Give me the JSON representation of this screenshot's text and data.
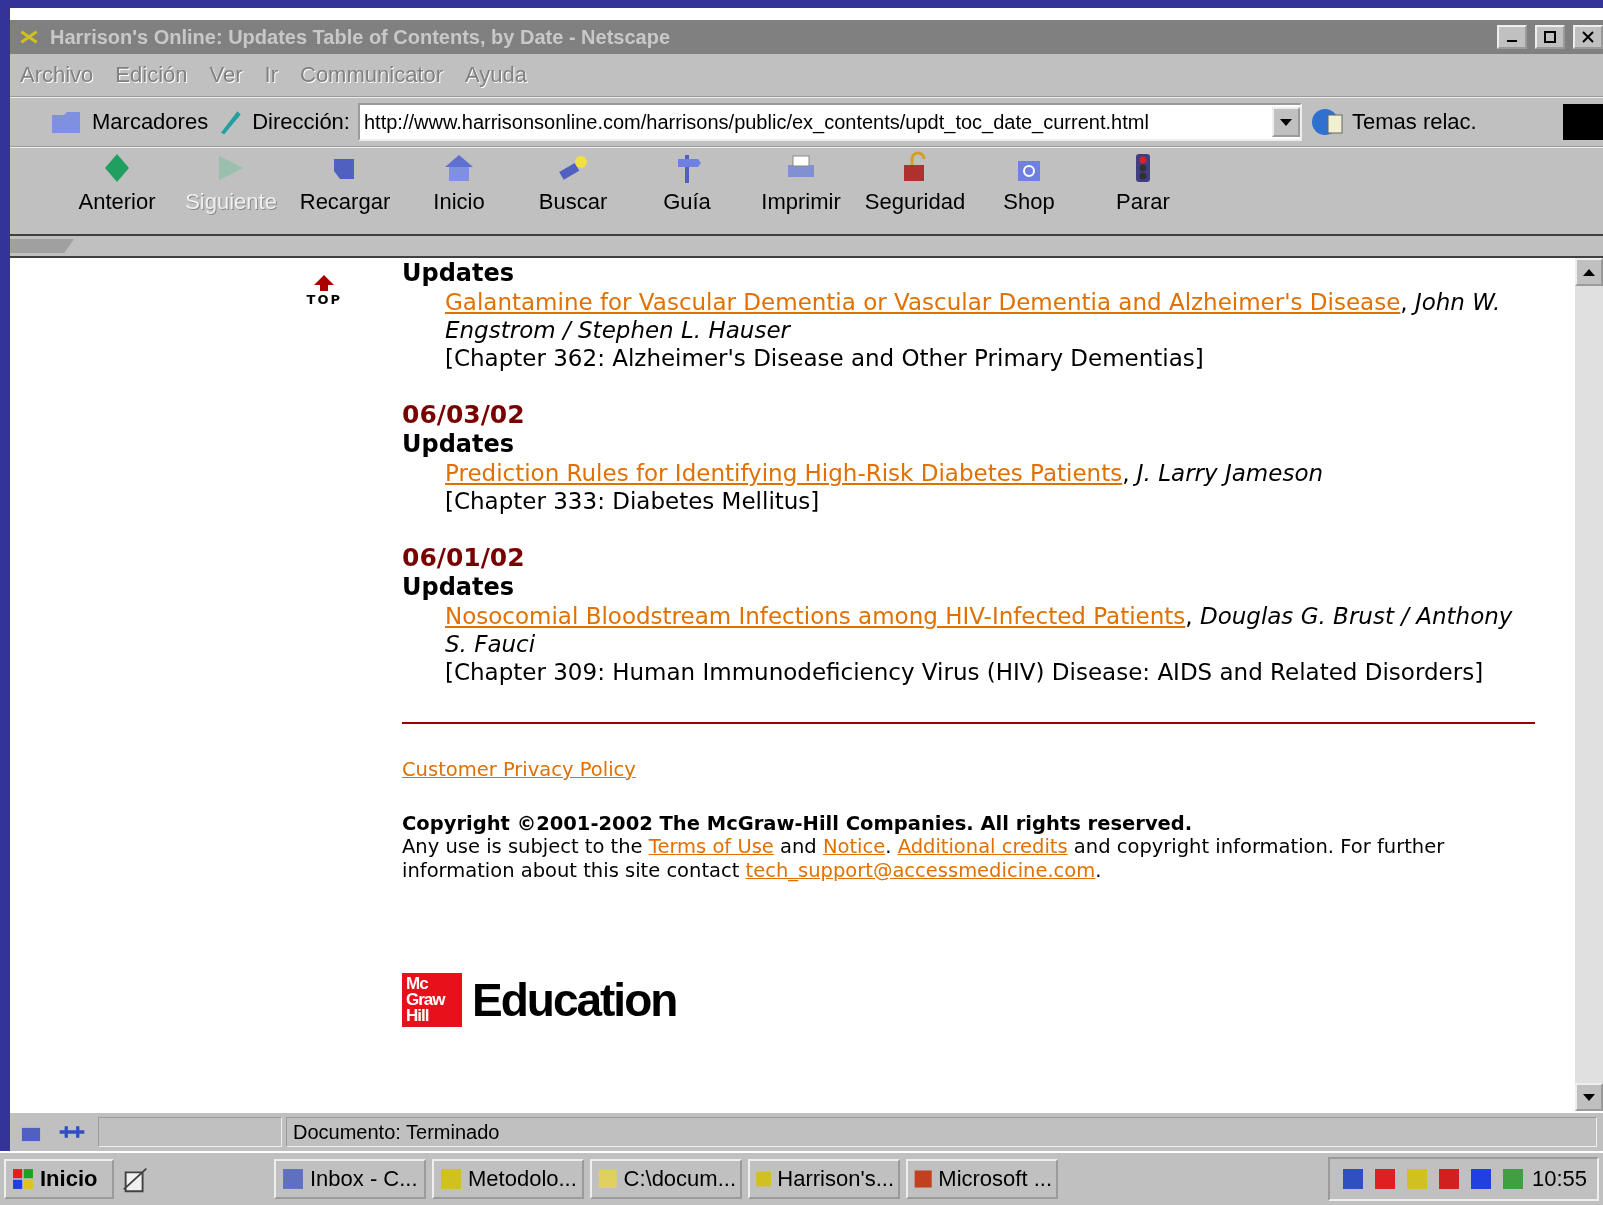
{
  "window": {
    "title": "Harrison's Online: Updates Table of Contents, by Date - Netscape"
  },
  "menu": [
    {
      "label": "Archivo"
    },
    {
      "label": "Edición"
    },
    {
      "label": "Ver"
    },
    {
      "label": "Ir"
    },
    {
      "label": "Communicator"
    },
    {
      "label": "Ayuda"
    }
  ],
  "location_bar": {
    "bookmarks": "Marcadores",
    "address_label": "Dirección:",
    "address": "http://www.harrisonsonline.com/harrisons/public/ex_contents/updt_toc_date_current.html",
    "related": "Temas relac."
  },
  "toolbar": [
    {
      "label": "Anterior",
      "disabled": false
    },
    {
      "label": "Siguiente",
      "disabled": true
    },
    {
      "label": "Recargar",
      "disabled": false
    },
    {
      "label": "Inicio",
      "disabled": false
    },
    {
      "label": "Buscar",
      "disabled": false
    },
    {
      "label": "Guía",
      "disabled": false
    },
    {
      "label": "Imprimir",
      "disabled": false
    },
    {
      "label": "Seguridad",
      "disabled": false
    },
    {
      "label": "Shop",
      "disabled": false
    },
    {
      "label": "Parar",
      "disabled": false
    }
  ],
  "content": {
    "top_label": "TOP",
    "sections": [
      {
        "heading": "Updates",
        "entries": [
          {
            "link": "Galantamine for Vascular Dementia or Vascular Dementia and Alzheimer's Disease",
            "rest": ", *John W. Engstrom / Stephen L. Hauser*",
            "chapter": "[Chapter 362: Alzheimer's Disease and Other Primary Dementias]"
          }
        ]
      },
      {
        "date": "06/03/02",
        "heading": "Updates",
        "entries": [
          {
            "link": "Prediction Rules for Identifying High-Risk Diabetes Patients",
            "rest": ", *J. Larry Jameson*",
            "chapter": "[Chapter 333: Diabetes Mellitus]"
          }
        ]
      },
      {
        "date": "06/01/02",
        "heading": "Updates",
        "entries": [
          {
            "link": "Nosocomial Bloodstream Infections among HIV-Infected Patients",
            "rest": ", *Douglas G. Brust / Anthony S. Fauci*",
            "chapter": "[Chapter 309: Human Immunodeficiency Virus (HIV) Disease: AIDS and Related Disorders]"
          }
        ]
      }
    ],
    "privacy_link": "Customer Privacy Policy",
    "copyright": "Copyright ©2001-2002 The McGraw-Hill Companies. All rights reserved.",
    "notice": [
      {
        "kind": "text",
        "text": "Any use is subject to the "
      },
      {
        "kind": "link",
        "text": "Terms of Use"
      },
      {
        "kind": "text",
        "text": " and "
      },
      {
        "kind": "link",
        "text": "Notice"
      },
      {
        "kind": "text",
        "text": ". "
      },
      {
        "kind": "link",
        "text": "Additional credits"
      },
      {
        "kind": "text",
        "text": " and copyright information. For further information about this site contact "
      },
      {
        "kind": "link",
        "text": "tech_support@accessmedicine.com"
      },
      {
        "kind": "text",
        "text": "."
      }
    ],
    "logo": {
      "mark": [
        "Mc",
        "Graw",
        "Hill"
      ],
      "word": "Education"
    }
  },
  "status_bar": {
    "text": "Documento: Terminado"
  },
  "taskbar": {
    "start": "Inicio",
    "tasks": [
      {
        "label": "Inbox - C..."
      },
      {
        "label": "Metodolo..."
      },
      {
        "label": "C:\\docum..."
      },
      {
        "label": "Harrison's..."
      },
      {
        "label": "Microsoft ..."
      }
    ],
    "clock": "10:55"
  }
}
